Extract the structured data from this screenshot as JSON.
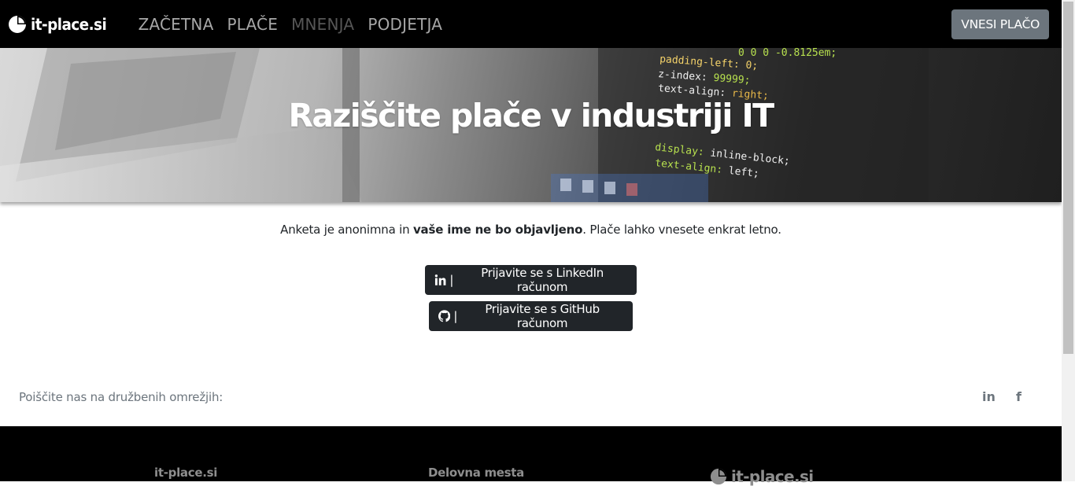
{
  "navbar": {
    "brand": "it-place.si",
    "links": [
      {
        "label": "ZAČETNA"
      },
      {
        "label": "PLAČE"
      },
      {
        "label": "MNENJA"
      },
      {
        "label": "PODJETJA"
      }
    ],
    "cta_label": "VNESI PLAČO"
  },
  "hero": {
    "title": "Raziščite plače v industriji IT",
    "code_lines": [
      "padding-left: 0;",
      "z-index: 99999;",
      "text-align: right;",
      "display: inline-block;",
      "text-align: left;"
    ]
  },
  "intro": {
    "text_before": "Anketa je anonimna in ",
    "text_bold": "vaše ime ne bo objavljeno",
    "text_after": ". Plače lahko vnesete enkrat letno."
  },
  "login": {
    "linkedin_label": "Prijavite se s LinkedIn računom",
    "github_label": "Prijavite se s GitHub računom",
    "separator": "|"
  },
  "social": {
    "text": "Poiščite nas na družbenih omrežjih:",
    "linkedin_glyph": "in",
    "facebook_glyph": "f"
  },
  "footer": {
    "col1_heading": "it-place.si",
    "col2_heading": "Delovna mesta",
    "logo_text": "it-place.si"
  },
  "colors": {
    "navbar_bg": "#000000",
    "cta_bg": "#6c757d",
    "dark_button": "#212529",
    "muted_text": "#6c757d"
  }
}
